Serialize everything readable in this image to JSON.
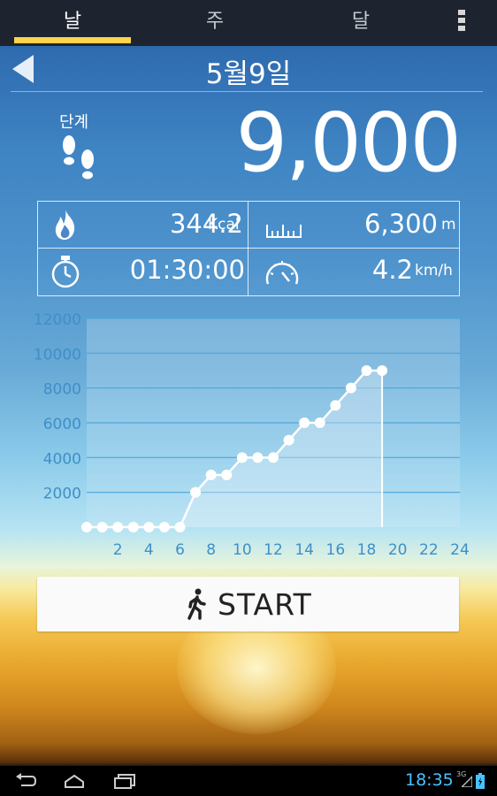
{
  "tabs": [
    {
      "label": "날",
      "active": true
    },
    {
      "label": "주",
      "active": false
    },
    {
      "label": "달",
      "active": false
    }
  ],
  "header": {
    "date": "5월9일"
  },
  "steps": {
    "label": "단계",
    "value": "9,000"
  },
  "stats": {
    "calories": {
      "value": "344.2",
      "unit": "Kcal",
      "icon": "flame-icon"
    },
    "distance": {
      "value": "6,300",
      "unit": "m",
      "icon": "ruler-icon"
    },
    "duration": {
      "value": "01:30:00",
      "icon": "stopwatch-icon"
    },
    "speed": {
      "value": "4.2",
      "unit": "km/h",
      "icon": "speedometer-icon"
    }
  },
  "chart_data": {
    "type": "area",
    "x": [
      0,
      1,
      2,
      3,
      4,
      5,
      6,
      7,
      8,
      9,
      10,
      11,
      12,
      13,
      14,
      15,
      16,
      17,
      18,
      19
    ],
    "values": [
      0,
      0,
      0,
      0,
      0,
      0,
      0,
      2000,
      3000,
      3000,
      4000,
      4000,
      4000,
      5000,
      6000,
      6000,
      7000,
      8000,
      9000,
      9000
    ],
    "xticks": [
      "2",
      "4",
      "6",
      "8",
      "10",
      "12",
      "14",
      "16",
      "18",
      "20",
      "22",
      "24"
    ],
    "yticks": [
      "2000",
      "4000",
      "6000",
      "8000",
      "10000",
      "12000"
    ],
    "xlim": [
      0,
      24
    ],
    "ylim": [
      0,
      12000
    ],
    "grid": true,
    "colors": {
      "line": "#ffffff",
      "fill": "#cfe6f2",
      "grid": "#4aa6dc",
      "tick": "#3f8fc8"
    }
  },
  "start_button": {
    "label": "START"
  },
  "status": {
    "clock": "18:35",
    "network": "3G"
  }
}
